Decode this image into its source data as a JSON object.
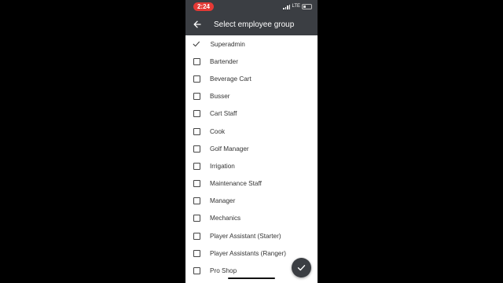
{
  "status_bar": {
    "time": "2:24",
    "network": "LTE"
  },
  "header": {
    "title": "Select employee group"
  },
  "groups": [
    {
      "label": "Superadmin",
      "checked": true
    },
    {
      "label": "Bartender",
      "checked": false
    },
    {
      "label": "Beverage Cart",
      "checked": false
    },
    {
      "label": "Busser",
      "checked": false
    },
    {
      "label": "Cart Staff",
      "checked": false
    },
    {
      "label": "Cook",
      "checked": false
    },
    {
      "label": "Golf Manager",
      "checked": false
    },
    {
      "label": "Irrigation",
      "checked": false
    },
    {
      "label": "Maintenance Staff",
      "checked": false
    },
    {
      "label": "Manager",
      "checked": false
    },
    {
      "label": "Mechanics",
      "checked": false
    },
    {
      "label": "Player Assistant (Starter)",
      "checked": false
    },
    {
      "label": "Player Assistants (Ranger)",
      "checked": false
    },
    {
      "label": "Pro Shop",
      "checked": false
    }
  ],
  "colors": {
    "app_bar": "#3b3e43",
    "time_pill": "#e53935"
  },
  "icons": {
    "back": "arrow-left-icon",
    "confirm": "check-icon"
  }
}
